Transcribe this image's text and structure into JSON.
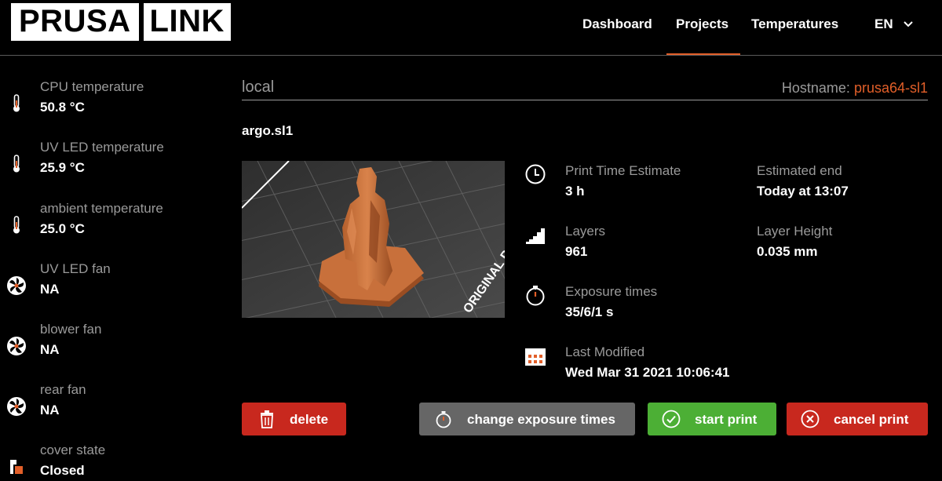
{
  "header": {
    "logo_part1": "PRUSA",
    "logo_part2": "LINK",
    "nav": [
      {
        "label": "Dashboard"
      },
      {
        "label": "Projects"
      },
      {
        "label": "Temperatures"
      }
    ],
    "language": "EN",
    "active_tab": "Projects"
  },
  "sidebar": {
    "items": [
      {
        "label": "CPU temperature",
        "value": "50.8 °C",
        "icon": "thermometer-icon"
      },
      {
        "label": "UV LED temperature",
        "value": "25.9 °C",
        "icon": "thermometer-icon"
      },
      {
        "label": "ambient temperature",
        "value": "25.0 °C",
        "icon": "thermometer-icon"
      },
      {
        "label": "UV LED fan",
        "value": "NA",
        "icon": "fan-icon"
      },
      {
        "label": "blower fan",
        "value": "NA",
        "icon": "fan-icon"
      },
      {
        "label": "rear fan",
        "value": "NA",
        "icon": "fan-icon"
      },
      {
        "label": "cover state",
        "value": "Closed",
        "icon": "cover-icon"
      }
    ]
  },
  "main": {
    "location": "local",
    "hostname_label": "Hostname: ",
    "hostname_value": "prusa64-sl1",
    "filename": "argo.sl1",
    "details": [
      {
        "label": "Print Time Estimate",
        "value": "3 h",
        "icon": "clock-icon"
      },
      {
        "label": "Layers",
        "value": "961",
        "icon": "layers-icon"
      },
      {
        "label": "Exposure times",
        "value": "35/6/1 s",
        "icon": "stopwatch-icon"
      },
      {
        "label": "Last Modified",
        "value": "Wed Mar 31 2021 10:06:41",
        "icon": "calendar-icon"
      }
    ],
    "meta": [
      {
        "label": "Estimated end",
        "value": "Today at 13:07"
      },
      {
        "label": "Layer Height",
        "value": "0.035 mm"
      }
    ],
    "preview_text": "ORIGINAL PRUSA"
  },
  "actions": {
    "delete": "delete",
    "change_exposure": "change exposure times",
    "start_print": "start print",
    "cancel_print": "cancel print"
  },
  "colors": {
    "accent": "#e25f29",
    "danger": "#c8281e",
    "success": "#4caf35",
    "neutral": "#666666",
    "muted_text": "#9a9a9a"
  }
}
